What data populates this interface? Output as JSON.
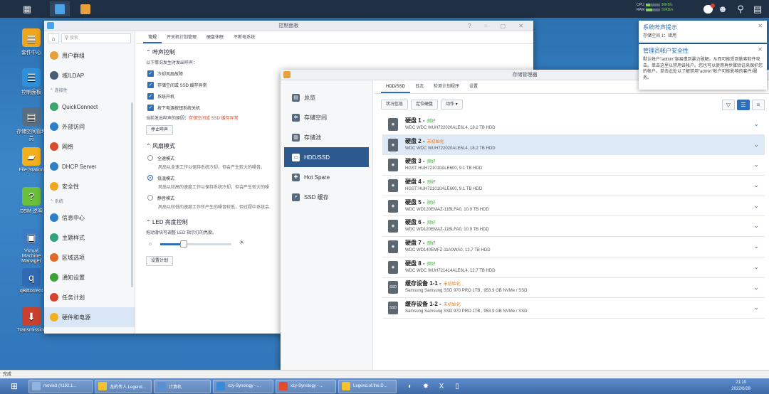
{
  "dsm": {
    "topbar": {
      "cpu_label": "CPU",
      "ram_label": "RAM",
      "upload": "36KB/s",
      "download": "59KB/s",
      "cpu_level": 0.3,
      "ram_level": 0.45
    },
    "desktop": [
      {
        "label": "套件中心",
        "color": "#f0a51d",
        "glyph": "▦"
      },
      {
        "label": "控制面板",
        "color": "#2f8fd8",
        "glyph": "☰"
      },
      {
        "label": "存储空间管理员",
        "color": "#5a6e82",
        "glyph": "▤"
      },
      {
        "label": "File Station",
        "color": "#f2b01e",
        "glyph": "▰"
      },
      {
        "label": "DSM 说明",
        "color": "#6abf3b",
        "glyph": "?"
      },
      {
        "label": "Virtual Machine Manager",
        "color": "#3b7cc4",
        "glyph": "▣"
      },
      {
        "label": "qBittorrent",
        "color": "#2f6ab3",
        "glyph": "q"
      },
      {
        "label": "Transmission",
        "color": "#c9402d",
        "glyph": "⬇"
      }
    ]
  },
  "control_panel": {
    "title": "控制面板",
    "search_placeholder": "搜索",
    "sidebar": [
      {
        "type": "item",
        "label": "用户群组",
        "color": "#e8a13a"
      },
      {
        "type": "item",
        "label": "域/LDAP",
        "color": "#4a5e76"
      },
      {
        "type": "section",
        "label": "连接性"
      },
      {
        "type": "item",
        "label": "QuickConnect",
        "color": "#3aa66b"
      },
      {
        "type": "item",
        "label": "外部访问",
        "color": "#2f7ec8"
      },
      {
        "type": "item",
        "label": "网络",
        "color": "#d94a2e"
      },
      {
        "type": "item",
        "label": "DHCP Server",
        "color": "#2f7ec8"
      },
      {
        "type": "item",
        "label": "安全性",
        "color": "#f0a51d"
      },
      {
        "type": "section",
        "label": "系统"
      },
      {
        "type": "item",
        "label": "信息中心",
        "color": "#2f7ec8"
      },
      {
        "type": "item",
        "label": "主题样式",
        "color": "#2fa37a"
      },
      {
        "type": "item",
        "label": "区域选项",
        "color": "#e06a2a"
      },
      {
        "type": "item",
        "label": "通知设置",
        "color": "#3aa335"
      },
      {
        "type": "item",
        "label": "任务计划",
        "color": "#d9432e"
      },
      {
        "type": "item",
        "label": "硬件和电源",
        "color": "#f2b01e",
        "selected": true
      }
    ],
    "tabs": [
      "常规",
      "开关机计划管理",
      "硬盘休眠",
      "不断电系统"
    ],
    "active_tab": 0,
    "beep": {
      "heading": "哔声控制",
      "intro": "以下情况发生时发出哔声：",
      "options": [
        "冷却风扇故障",
        "存储空间或 SSD 缓存异常",
        "系统开机",
        "按下电源按钮系统关机"
      ],
      "reason_label": "当前发出哔声的原因：",
      "reason_value": "存储空间或 SSD 缓存异常",
      "stop_button": "停止哔声"
    },
    "fan": {
      "heading": "风扇模式",
      "modes": [
        {
          "label": "全速模式",
          "desc": "风扇以全速工作以保持系统冷却，但会产生较大的噪音。"
        },
        {
          "label": "低温模式",
          "desc": "风扇以较高的速度工作以保持系统冷却，但会产生较大的噪",
          "selected": true
        },
        {
          "label": "静音模式",
          "desc": "风扇以较低的速度工作所产生的噪音较低，但过程中系统会"
        }
      ]
    },
    "led": {
      "heading": "LED 亮度控制",
      "desc": "拖动滑块可调整 LED 指示灯的亮度。",
      "level": 0.33,
      "schedule_button": "设置计划"
    }
  },
  "storage_manager": {
    "title": "存储管理器",
    "nav": [
      {
        "label": "总览",
        "glyph": "▤"
      },
      {
        "label": "存储空间",
        "glyph": "✲"
      },
      {
        "label": "存储池",
        "glyph": "▥"
      },
      {
        "label": "HDD/SSD",
        "glyph": "▭",
        "selected": true
      },
      {
        "label": "Hot Spare",
        "glyph": "✚"
      },
      {
        "label": "SSD 缓存",
        "glyph": "⚡"
      }
    ],
    "tabs": [
      "HDD/SSD",
      "日志",
      "检测计划程序",
      "设置"
    ],
    "toolbar": [
      "状况信息",
      "定位硬盘",
      "动作 ▾"
    ],
    "disks": [
      {
        "name": "硬盘 1",
        "status": "良好",
        "state": "ok",
        "model": "WDC WDC WUH722020ALE6L4, 18.2 TB HDD",
        "kind": "hdd"
      },
      {
        "name": "硬盘 2",
        "status": "未初始化",
        "state": "init",
        "model": "WDC WDC WUH722020ALE6L4, 18.2 TB HDD",
        "kind": "hdd",
        "selected": true
      },
      {
        "name": "硬盘 3",
        "status": "良好",
        "state": "ok",
        "model": "HGST HUH721010ALE600, 9.1 TB HDD",
        "kind": "hdd"
      },
      {
        "name": "硬盘 4",
        "status": "良好",
        "state": "ok",
        "model": "HGST HUH721010ALE600, 9.1 TB HDD",
        "kind": "hdd"
      },
      {
        "name": "硬盘 5",
        "status": "良好",
        "state": "ok",
        "model": "WDC WD120EMAZ-11BLFA0, 10.9 TB HDD",
        "kind": "hdd"
      },
      {
        "name": "硬盘 6",
        "status": "良好",
        "state": "ok",
        "model": "WDC WD120EMAZ-11BLFA0, 10.9 TB HDD",
        "kind": "hdd"
      },
      {
        "name": "硬盘 7",
        "status": "良好",
        "state": "ok",
        "model": "WDC WD140EMFZ-11A0WA0, 12.7 TB HDD",
        "kind": "hdd"
      },
      {
        "name": "硬盘 8",
        "status": "良好",
        "state": "ok",
        "model": "WDC WDC WUH721414ALE6L4, 12.7 TB HDD",
        "kind": "hdd"
      },
      {
        "name": "缓存设备 1-1",
        "status": "未初始化",
        "state": "init",
        "model": "Samsung Samsung SSD 970 PRO 1TB , 953.9 GB NVMe / SSD",
        "kind": "ssd"
      },
      {
        "name": "缓存设备 1-2",
        "status": "未初始化",
        "state": "init",
        "model": "Samsung Samsung SSD 970 PRO 1TB , 953.9 GB NVMe / SSD",
        "kind": "ssd"
      }
    ]
  },
  "notifications": [
    {
      "title": "系统哔声提示",
      "body": "存储空间 1：错用"
    },
    {
      "title": "管理员帐户安全性",
      "body": "默认帐户\"admin\"容易遭到暴力破解，从而可能受到勒索软件攻击。单击这里以禁用该帐户。您也可以使用再步骤验证来保护您的帐户。单击此处以了解禁用\"admin\"帐户可能影响的套件/服务。"
    }
  ],
  "browser_status": "完成",
  "windows_taskbar": {
    "buttons": [
      {
        "label": "movie3 (\\\\192.1...",
        "color": "#8fb4e0"
      },
      {
        "label": "龙的传人.Legend...",
        "color": "#f2c230"
      },
      {
        "label": "计算机",
        "color": "#5a8fd0"
      },
      {
        "label": "xzy-Synology - ...",
        "color": "#3a8ad9"
      },
      {
        "label": "xzy-Synology - ...",
        "color": "#e34b2e"
      },
      {
        "label": "Legend.of.the.D...",
        "color": "#f2c230"
      }
    ],
    "time": "21:10",
    "date": "2022/6/28"
  }
}
